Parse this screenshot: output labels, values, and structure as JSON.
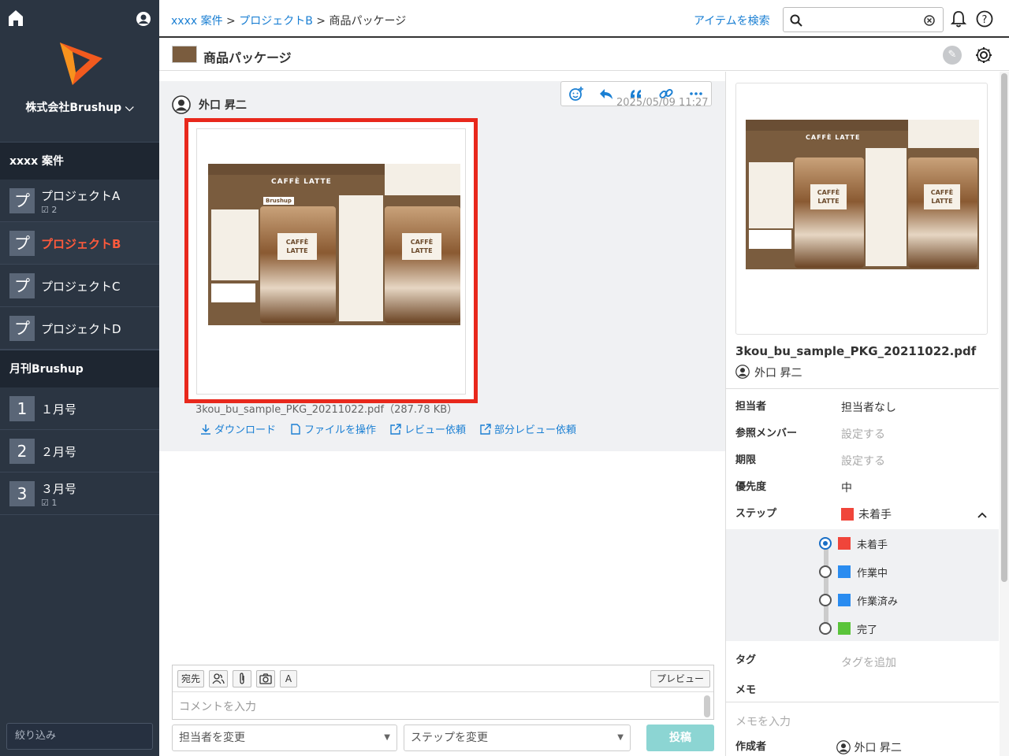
{
  "sidebar": {
    "company": "株式会社Brushup ⌵",
    "groups": [
      {
        "title": "xxxx 案件",
        "items": [
          {
            "icon": "プ",
            "label": "プロジェクトA",
            "sub": "☑ 2"
          },
          {
            "icon": "プ",
            "label": "プロジェクトB",
            "sub": ""
          },
          {
            "icon": "プ",
            "label": "プロジェクトC",
            "sub": ""
          },
          {
            "icon": "プ",
            "label": "プロジェクトD",
            "sub": ""
          }
        ]
      },
      {
        "title": "月刊Brushup",
        "items": [
          {
            "icon": "1",
            "label": "１月号",
            "sub": ""
          },
          {
            "icon": "2",
            "label": "２月号",
            "sub": ""
          },
          {
            "icon": "3",
            "label": "３月号",
            "sub": "☑ 1"
          }
        ]
      }
    ],
    "filter_placeholder": "絞り込み"
  },
  "topbar": {
    "breadcrumb": [
      "xxxx 案件",
      "プロジェクトB",
      "商品パッケージ"
    ],
    "search_link": "アイテムを検索",
    "search_value": ""
  },
  "title": "商品パッケージ",
  "post": {
    "author": "外口 昇二",
    "timestamp": "2025/05/09 11:27",
    "file": "3kou_bu_sample_PKG_20211022.pdf（287.78 KB）",
    "actions": [
      "ダウンロード",
      "ファイルを操作",
      "レビュー依頼",
      "部分レビュー依頼"
    ],
    "package_title": "CAFFÈ LATTE",
    "brand": "Brushup",
    "cup_label": "CAFFÈ LATTE"
  },
  "composer": {
    "btn_to": "宛先",
    "btn_font": "A",
    "btn_preview": "プレビュー",
    "placeholder": "コメントを入力",
    "assignee_select": "担当者を変更",
    "step_select": "ステップを変更",
    "submit": "投稿"
  },
  "panel": {
    "filename": "3kou_bu_sample_PKG_20211022.pdf",
    "owner": "外口 昇二",
    "props": {
      "assignee_label": "担当者",
      "assignee_value": "担当者なし",
      "members_label": "参照メンバー",
      "members_value": "設定する",
      "due_label": "期限",
      "due_value": "設定する",
      "priority_label": "優先度",
      "priority_value": "中",
      "step_label": "ステップ",
      "step_value": "未着手",
      "tag_label": "タグ",
      "tag_value": "タグを追加",
      "memo_label": "メモ",
      "memo_placeholder": "メモを入力",
      "creator_label": "作成者",
      "creator_value": "外口 昇二"
    },
    "steps": [
      {
        "label": "未着手",
        "color": "#f0453a",
        "selected": true
      },
      {
        "label": "作業中",
        "color": "#2a8cf0",
        "selected": false
      },
      {
        "label": "作業済み",
        "color": "#2a8cf0",
        "selected": false
      },
      {
        "label": "完了",
        "color": "#5ac43a",
        "selected": false
      }
    ]
  },
  "colors": {
    "accent": "#1a7fd3",
    "active_item": "#ff5a3c",
    "highlight_frame": "#e8281c",
    "sidebar_bg": "#2b3542"
  }
}
